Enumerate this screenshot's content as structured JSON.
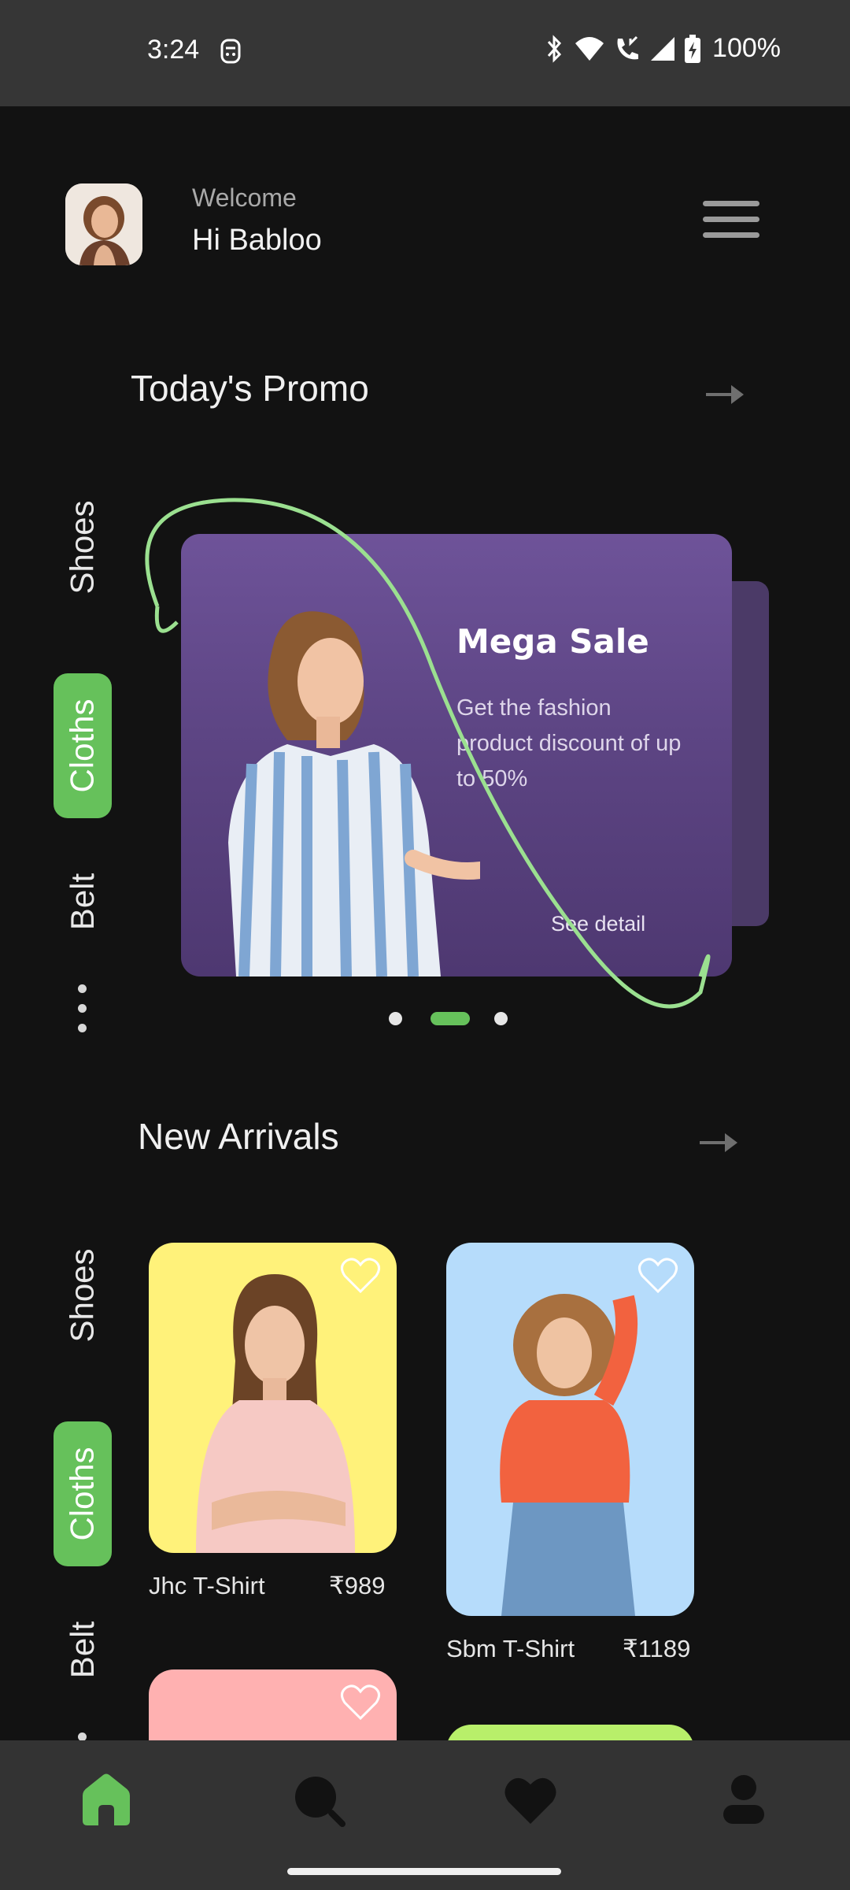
{
  "status_bar": {
    "time": "3:24",
    "battery": "100%",
    "icons": [
      "face-icon",
      "bluetooth-icon",
      "wifi-icon",
      "call-icon",
      "signal-icon",
      "battery-icon"
    ]
  },
  "header": {
    "welcome": "Welcome",
    "greeting": "Hi Babloo"
  },
  "promo": {
    "section_title": "Today's Promo",
    "categories": [
      "Shoes",
      "Cloths",
      "Belt"
    ],
    "active_category": "Cloths",
    "card": {
      "title": "Mega Sale",
      "description": "Get the fashion product discount of up to 50%",
      "link": "See detail"
    },
    "pages": 3,
    "active_page": 2
  },
  "new_arrivals": {
    "section_title": "New Arrivals",
    "categories": [
      "Shoes",
      "Cloths",
      "Belt"
    ],
    "active_category": "Cloths",
    "products": [
      {
        "name": "Jhc T-Shirt",
        "price": "₹989",
        "bg": "#fff27a"
      },
      {
        "name": "Sbm T-Shirt",
        "price": "₹1189",
        "bg": "#b6dcfb"
      },
      {
        "name": "",
        "price": "",
        "bg": "#ffb1b1"
      },
      {
        "name": "",
        "price": "",
        "bg": "#b8ef6a"
      }
    ]
  },
  "bottom_nav": {
    "items": [
      "home-icon",
      "search-icon",
      "heart-icon",
      "profile-icon"
    ],
    "active": "home-icon",
    "accent": "#66c15b",
    "inactive": "#121212"
  }
}
